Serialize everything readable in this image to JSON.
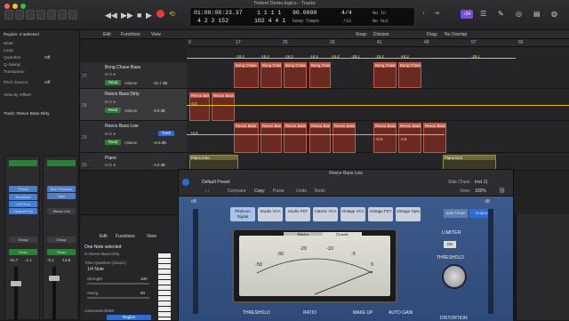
{
  "window": {
    "title": "Trident Demo.logicx - Tracks"
  },
  "lcd": {
    "position": "01:00:08:23.37",
    "bars": "4 2 2 152",
    "beat_top": "1 1 1 1",
    "beat_bot": "102 4 4 1",
    "tempo": "90.0000",
    "tempo_mode": "Keep Tempo",
    "sig_top": "4/4",
    "sig_bot": "/16",
    "in": "No In",
    "out": "No Out"
  },
  "badge": "♪34",
  "inspector": {
    "region_header": "Region: 2 selected",
    "rows": [
      {
        "label": "Mute:",
        "value": ""
      },
      {
        "label": "Loop:",
        "value": ""
      },
      {
        "label": "Quantize:",
        "value": "Off"
      },
      {
        "label": "Q-Swing:",
        "value": ""
      },
      {
        "label": "Transpose:",
        "value": ""
      },
      {
        "label": "Pitch Source:",
        "value": "Off"
      },
      {
        "label": "Velocity Offset:",
        "value": ""
      }
    ],
    "track_header": "Track: Reece Bass Dirty"
  },
  "strips": [
    {
      "name": "Trident",
      "plug1": "Blackhole",
      "plug2": "LFOTool",
      "plug3": "Channel EQ",
      "group": "Group",
      "mode": "Read",
      "val1": "-31.7",
      "val2": "-1.1"
    },
    {
      "name": "Stereo Out",
      "plug1": "Bus Pressure",
      "plug2": "Tape",
      "plug3": "",
      "group": "Group",
      "mode": "Read",
      "val1": "-0.1",
      "val2": "-13.9"
    }
  ],
  "toolbar": {
    "edit": "Edit",
    "functions": "Functions",
    "view": "View",
    "snap_label": "Snap:",
    "snap": "Division",
    "drag_label": "Drag:",
    "drag": "No Overlap"
  },
  "ruler": [
    "9",
    "17",
    "25",
    "33",
    "41",
    "49",
    "57",
    "65"
  ],
  "tracks": [
    {
      "num": "27",
      "name": "Bong Chase Bass",
      "vol": "-31.7 dB"
    },
    {
      "num": "28",
      "name": "Reece Bass Dirty",
      "vol": "-3.0 dB"
    },
    {
      "num": "29",
      "name": "Reece Bass Low",
      "vol": "+2.9 dB"
    },
    {
      "num": "30",
      "name": "Piano",
      "vol": "-2.0 dB"
    }
  ],
  "track_labels": {
    "read": "Read",
    "volume": "Volume",
    "track": "Track",
    "ms": "M  S  ●"
  },
  "region_names": {
    "bong": "Bong Chase",
    "dirty": "Reece Bass",
    "low": "Reece Bass",
    "piano1": "Piano Intro",
    "piano2": "Piano End"
  },
  "auto_labels": [
    "-19.2",
    "-16.3",
    "-16.2",
    "-16.3",
    "-16.2",
    "-28.1",
    "-16.2",
    "-16.2",
    "-29.1",
    "-3.0",
    "+2.9",
    "+0.6",
    "-2.8"
  ],
  "plugin": {
    "title": "Reece Bass Low",
    "preset": "Default Preset",
    "actions": [
      "Compare",
      "Copy",
      "Paste",
      "Undo",
      "Redo"
    ],
    "sidechain_label": "Side Chain:",
    "sidechain": "Inst 11",
    "view_label": "View:",
    "view": "100%",
    "models": [
      "Platinum Digital",
      "Studio VCA",
      "Studio FET",
      "Classic VCA",
      "Vintage VCA",
      "Vintage FET",
      "Vintage Opto"
    ],
    "tabs": [
      "Side Chain",
      "Output"
    ],
    "meter_tabs": [
      "Meter",
      "Graph"
    ],
    "scale": [
      "-50",
      "-30",
      "-20",
      "-10",
      "-5",
      "0"
    ],
    "limiter": "LIMITER",
    "on": "ON",
    "threshold_r": "THRESHOLD",
    "bottom": [
      "THRESHOLD",
      "RATIO",
      "MAKE UP",
      "AUTO GAIN",
      "DISTORTION"
    ],
    "db": "dB"
  },
  "editor": {
    "menus": [
      "Edit",
      "Functions",
      "View"
    ],
    "note_sel": "One Note selected",
    "sub": "in Reece Bass Dirty",
    "tq_label": "Time Quantize (classic)",
    "tq": "1/4 Note",
    "strength": "Strength",
    "strength_v": "100",
    "swing": "Swing",
    "swing_v": "50",
    "automation": "Automation/MIDI",
    "region": "Region"
  }
}
